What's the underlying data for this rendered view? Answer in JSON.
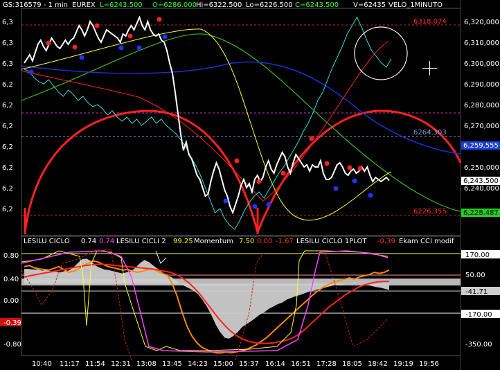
{
  "header": {
    "symbol": "GS:316579 - 1 min",
    "exchange": "EUREX",
    "last": "L=6243.500",
    "open": "O=6286.000",
    "high": "Hi=6322.500",
    "low": "Lo=6226.500",
    "close": "C=6243.500",
    "volume": "V=62435",
    "template": "VELO_1MINUTO"
  },
  "price_panel": {
    "left_labels": [
      "6,3",
      "6,3",
      "6,3",
      "6,2",
      "6,2",
      "6,2",
      "6,2",
      "6,2",
      "6,2",
      "6,2"
    ],
    "right_axis": [
      "6,320,000",
      "6,310,000",
      "6,300,000",
      "6,290,000",
      "6,280,000",
      "6,270,000",
      "6,250,000",
      "6,240,000"
    ],
    "level_high": "6318.074",
    "level_mid": "6264.303",
    "level_low": "6226.355",
    "badge_mid": "6,259,555",
    "badge_last": "6,243.500",
    "badge_low": "6,228.487"
  },
  "indicator_panel": {
    "legend": [
      {
        "text": "LESILU CICLO",
        "color": "#ffffff"
      },
      {
        "text": "0.74",
        "color": "#ffffff"
      },
      {
        "text": "0.74",
        "color": "#ff44ff"
      },
      {
        "text": "LESILU CICLI 2",
        "color": "#ffffff"
      },
      {
        "text": "99.25",
        "color": "#ffff00"
      },
      {
        "text": "Momentum",
        "color": "#ffffff"
      },
      {
        "text": "7.50",
        "color": "#ffff00"
      },
      {
        "text": "0.00",
        "color": "#ff3333"
      },
      {
        "text": "-1.67",
        "color": "#ff3333"
      },
      {
        "text": "LESILU CICLO 1PLOT",
        "color": "#ffffff"
      },
      {
        "text": "-0.39",
        "color": "#ff3333"
      },
      {
        "text": "Ekam CCI modif",
        "color": "#ffffff"
      }
    ],
    "left_axis": [
      "0.80",
      "0.40",
      "0.00",
      "-0.39",
      "-0.80"
    ],
    "right_axis": [
      "170.00",
      "50.00",
      "-41.71",
      "-170.00",
      "-350.00"
    ]
  },
  "time_axis": [
    "10:40",
    "11:17",
    "11:54",
    "12:31",
    "13:08",
    "13:45",
    "14:23",
    "15:00",
    "15:37",
    "16:14",
    "16:51",
    "17:28",
    "18:05",
    "18:42",
    "19:19",
    "19:56"
  ],
  "colors": {
    "price": "#ffffff",
    "cyan_line": "#33dddd",
    "red": "#ff2222",
    "blue": "#1a2fd0",
    "green": "#33bb22",
    "yellow": "#ffff33",
    "magenta": "#ff44ff",
    "orange": "#ff8800",
    "gray_area": "#c8c8c8"
  },
  "price_series": [
    6300,
    6302,
    6304,
    6301,
    6305,
    6309,
    6311,
    6308,
    6306,
    6309,
    6312,
    6310,
    6308,
    6307,
    6309,
    6311,
    6309,
    6311,
    6312,
    6315,
    6318,
    6316,
    6313,
    6316,
    6320,
    6318,
    6315,
    6312,
    6310,
    6313,
    6316,
    6315,
    6314,
    6313,
    6312,
    6310,
    6314,
    6313,
    6316,
    6318,
    6316,
    6319,
    6322,
    6318,
    6316,
    6320,
    6316,
    6314,
    6313,
    6314,
    6311,
    6310,
    6306,
    6300,
    6295,
    6286,
    6276,
    6266,
    6258,
    6262,
    6256,
    6254,
    6250,
    6246,
    6244,
    6240,
    6236,
    6237,
    6243,
    6248,
    6252,
    6249,
    6244,
    6239,
    6236,
    6231,
    6228,
    6232,
    6236,
    6241,
    6244,
    6240,
    6242,
    6238,
    6244,
    6246,
    6243,
    6245,
    6250,
    6253,
    6249,
    6247,
    6251,
    6254,
    6257,
    6255,
    6250,
    6247,
    6252,
    6256,
    6254,
    6252,
    6250,
    6251,
    6248,
    6251,
    6250,
    6250,
    6253,
    6247,
    6244,
    6244,
    6245,
    6248,
    6251,
    6252,
    6250,
    6247,
    6246,
    6248,
    6249,
    6247,
    6248,
    6250,
    6248,
    6250,
    6246,
    6243,
    6245,
    6244,
    6243,
    6244,
    6245,
    6243.5
  ],
  "cyan_series": [
    6297,
    6296,
    6293,
    6291,
    6290,
    6292,
    6289,
    6286,
    6284,
    6287,
    6285,
    6282,
    6284,
    6281,
    6279,
    6280,
    6278,
    6275,
    6277,
    6274,
    6272,
    6274,
    6271,
    6273,
    6270,
    6272,
    6274,
    6271,
    6273,
    6270,
    6268,
    6266,
    6263,
    6260,
    6255,
    6251,
    6246,
    6240,
    6234,
    6228,
    6230,
    6225,
    6222,
    6220,
    6224,
    6229,
    6233,
    6236,
    6238,
    6235,
    6239,
    6243,
    6247,
    6250,
    6254,
    6258,
    6262,
    6267,
    6271,
    6276,
    6282,
    6286,
    6292,
    6298,
    6303,
    6308,
    6314,
    6318,
    6322,
    6317,
    6311,
    6306,
    6303,
    6300,
    6298,
    6302
  ],
  "dots_red": [
    [
      70,
      62
    ],
    [
      108,
      68
    ],
    [
      140,
      37
    ],
    [
      188,
      52
    ],
    [
      230,
      28
    ],
    [
      342,
      232
    ],
    [
      374,
      262
    ],
    [
      409,
      250
    ],
    [
      450,
      200
    ],
    [
      472,
      236
    ],
    [
      505,
      242
    ],
    [
      520,
      243
    ]
  ],
  "dots_blue": [
    [
      45,
      104
    ],
    [
      118,
      83
    ],
    [
      175,
      69
    ],
    [
      201,
      69
    ],
    [
      238,
      53
    ],
    [
      326,
      290
    ],
    [
      368,
      298
    ],
    [
      388,
      295
    ],
    [
      485,
      272
    ],
    [
      512,
      261
    ],
    [
      535,
      282
    ]
  ],
  "lower_gray": [
    0.56,
    0.56,
    0.55,
    0.55,
    0.53,
    0.54,
    0.52,
    0.51,
    0.5,
    0.52,
    0.53,
    0.58,
    0.66,
    0.73,
    0.74,
    0.7,
    0.62,
    0.58,
    0.55,
    0.54,
    0.52,
    0.5,
    0.48,
    0.5,
    0.52,
    0.58,
    0.66,
    0.72,
    0.68,
    0.62,
    0.56,
    0.5,
    0.45,
    0.42,
    0.36,
    0.3,
    0.26,
    0.22,
    0.18,
    0.12,
    0.02,
    -0.1,
    -0.24,
    -0.42,
    -0.55,
    -0.65,
    -0.67,
    -0.62,
    -0.55,
    -0.46,
    -0.41,
    -0.36,
    -0.3,
    -0.24,
    -0.2,
    -0.14,
    -0.1,
    -0.06,
    -0.03,
    0.02,
    0.05,
    0.08,
    0.1,
    0.13,
    0.16,
    0.18,
    0.2,
    0.22,
    0.24,
    0.26,
    0.28,
    0.27,
    0.29,
    0.3,
    0.32,
    0.31,
    0.3,
    0.28,
    0.26,
    0.24,
    0.23,
    0.21,
    0.19
  ],
  "lower_orange": [
    0.6,
    0.62,
    0.58,
    0.56,
    0.55,
    0.54,
    0.57,
    0.6,
    0.55,
    0.5,
    0.52,
    0.56,
    0.62,
    0.66,
    0.7,
    0.68,
    0.64,
    0.6,
    0.58,
    0.56,
    0.54,
    0.55,
    0.52,
    0.5,
    0.52,
    0.55,
    0.56,
    0.52,
    0.48,
    0.45,
    0.3,
    0.08,
    -0.2,
    -0.45,
    -0.62,
    -0.74,
    -0.82,
    -0.86,
    -0.9,
    -0.92,
    -0.92,
    -0.9,
    -0.92,
    -0.9,
    -0.88,
    -0.86,
    -0.82,
    -0.78,
    -0.72,
    -0.66,
    -0.58,
    -0.5,
    -0.42,
    -0.34,
    -0.26,
    -0.18,
    -0.1,
    -0.02,
    0.06,
    0.14,
    0.2,
    0.26,
    0.3,
    0.33,
    0.36,
    0.38,
    0.4,
    0.38,
    0.42,
    0.44,
    0.46,
    0.5,
    0.48,
    0.5,
    0.54
  ],
  "lower_red": [
    0.42,
    0.44,
    0.46,
    0.48,
    0.5,
    0.52,
    0.54,
    0.56,
    0.58,
    0.6,
    0.62,
    0.63,
    0.64,
    0.64,
    0.63,
    0.62,
    0.61,
    0.6,
    0.59,
    0.58,
    0.57,
    0.56,
    0.54,
    0.52,
    0.5,
    0.46,
    0.4,
    0.32,
    0.22,
    0.1,
    -0.04,
    -0.18,
    -0.32,
    -0.44,
    -0.54,
    -0.62,
    -0.68,
    -0.72,
    -0.74,
    -0.75,
    -0.75,
    -0.74,
    -0.72,
    -0.7,
    -0.66,
    -0.6,
    -0.52,
    -0.42,
    -0.32,
    -0.22,
    -0.12,
    -0.04,
    0.04,
    0.12,
    0.18,
    0.24,
    0.28,
    0.31,
    0.33,
    0.34,
    0.34
  ]
}
